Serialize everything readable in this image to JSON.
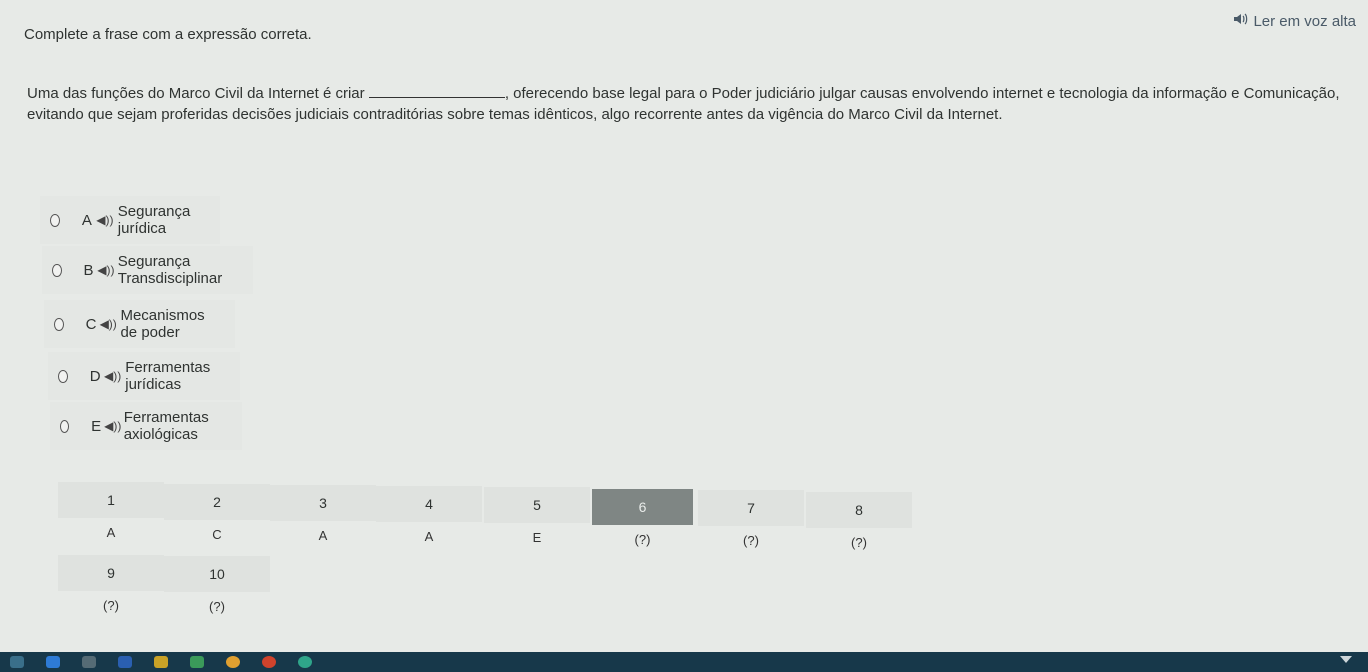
{
  "header": {
    "read_aloud_label": "Ler em voz alta",
    "read_aloud_icon": "speaker-icon"
  },
  "instruction": "Complete a frase com a expressão correta.",
  "question": {
    "before_blank": "Uma das funções do Marco Civil da Internet é criar",
    "after_blank": ", oferecendo base legal para o Poder judiciário julgar causas envolvendo internet e tecnologia da informação e Comunicação, evitando que sejam proferidas decisões judiciais contraditórias sobre temas idênticos, algo recorrente antes da vigência do Marco Civil da Internet."
  },
  "options": [
    {
      "letter": "A",
      "text": "Segurança jurídica"
    },
    {
      "letter": "B",
      "text": "Segurança Transdisciplinar"
    },
    {
      "letter": "C",
      "text": "Mecanismos de poder"
    },
    {
      "letter": "D",
      "text": "Ferramentas jurídicas"
    },
    {
      "letter": "E",
      "text": "Ferramentas axiológicas"
    }
  ],
  "answer_grid": [
    {
      "number": "1",
      "answer": "A"
    },
    {
      "number": "2",
      "answer": "C"
    },
    {
      "number": "3",
      "answer": "A"
    },
    {
      "number": "4",
      "answer": "A"
    },
    {
      "number": "5",
      "answer": "E"
    },
    {
      "number": "6",
      "answer": "(?)",
      "current": true
    },
    {
      "number": "7",
      "answer": "(?)"
    },
    {
      "number": "8",
      "answer": "(?)"
    },
    {
      "number": "9",
      "answer": "(?)"
    },
    {
      "number": "10",
      "answer": "(?)"
    }
  ],
  "colors": {
    "background": "#e7eae7",
    "current_question": "#7f8684",
    "taskbar": "#17384a"
  }
}
